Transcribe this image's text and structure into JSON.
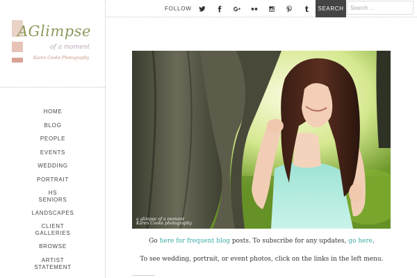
{
  "logo": {
    "title": "AGlimpse",
    "tagline": "of a moment",
    "credit": "Karen Cooke Photography"
  },
  "nav": {
    "items": [
      {
        "label": "HOME"
      },
      {
        "label": "BLOG"
      },
      {
        "label": "PEOPLE"
      },
      {
        "label": "EVENTS"
      },
      {
        "label": "WEDDING"
      },
      {
        "label": "PORTRAIT"
      },
      {
        "label_line1": "HS",
        "label_line2": "SENIORS"
      },
      {
        "label": "LANDSCAPES"
      },
      {
        "label_line1": "CLIENT",
        "label_line2": "GALLERIES"
      },
      {
        "label": "BROWSE"
      },
      {
        "label_line1": "ARTIST",
        "label_line2": "STATEMENT"
      }
    ]
  },
  "topbar": {
    "follow_label": "FOLLOW",
    "social_icons": [
      "twitter-icon",
      "facebook-icon",
      "google-plus-icon",
      "flickr-icon",
      "instagram-icon",
      "pinterest-icon",
      "tumblr-icon"
    ],
    "search_button": "SEARCH",
    "search_placeholder": "Search ..."
  },
  "main": {
    "photo_watermark_line1": "a glimpse of a moment",
    "photo_watermark_line2": "Karen Cooke photography",
    "line1": {
      "before": "Go ",
      "link1": "here for frequent blog",
      "middle": " posts.  To subscribe for any updates, ",
      "link2": "go here",
      "after": "."
    },
    "line2": "To see wedding, portrait, or event photos, click on the links in the left menu."
  },
  "colors": {
    "link": "#3aa9a4",
    "search_button_bg": "#444444",
    "logo_green": "#8a9a5b",
    "logo_pink": "#e6c3b6"
  }
}
